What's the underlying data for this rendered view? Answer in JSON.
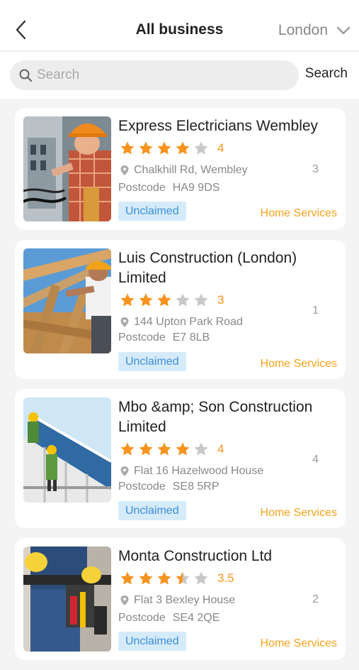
{
  "header": {
    "title": "All business",
    "city": "London",
    "back_icon": "back-arrow-icon",
    "dropdown_icon": "chevron-down-icon"
  },
  "search": {
    "placeholder": "Search",
    "button_label": "Search",
    "icon": "search-icon"
  },
  "colors": {
    "star_filled": "#f7931e",
    "star_empty": "#c8c8c8",
    "badge_bg": "#d6ebfa",
    "badge_text": "#3a8fd8",
    "category": "#f7a21a"
  },
  "listings": [
    {
      "name": "Express Electricians Wembley",
      "rating": 4,
      "rating_label": "4",
      "address": "Chalkhill Rd, Wembley",
      "postcode_label": "Postcode",
      "postcode": "HA9 9DS",
      "count": "3",
      "badge": "Unclaimed",
      "category": "Home Services",
      "image": "electrician-photo"
    },
    {
      "name": "Luis Construction (London) Limited",
      "rating": 3,
      "rating_label": "3",
      "address": "144 Upton Park Road",
      "postcode_label": "Postcode",
      "postcode": "E7 8LB",
      "count": "1",
      "badge": "Unclaimed",
      "category": "Home Services",
      "image": "carpenter-photo"
    },
    {
      "name": "Mbo &amp; Son Construction Limited",
      "rating": 4,
      "rating_label": "4",
      "address": "Flat 16 Hazelwood House",
      "postcode_label": "Postcode",
      "postcode": "SE8 5RP",
      "count": "4",
      "badge": "Unclaimed",
      "category": "Home Services",
      "image": "roofers-photo"
    },
    {
      "name": "Monta Construction Ltd",
      "rating": 3.5,
      "rating_label": "3.5",
      "address": "Flat 3 Bexley House",
      "postcode_label": "Postcode",
      "postcode": "SE4 2QE",
      "count": "2",
      "badge": "Unclaimed",
      "category": "Home Services",
      "image": "tool-belt-photo"
    }
  ]
}
